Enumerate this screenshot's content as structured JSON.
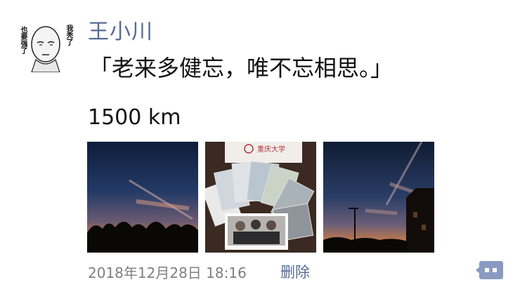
{
  "post": {
    "user_name": "王小川",
    "text": "「老来多健忘，唯不忘相思。」",
    "distance": "1500 km",
    "timestamp": "2018年12月28日 18:16",
    "delete_label": "删除",
    "photos": [
      {
        "subject": "dusk sky with contrail over tree silhouettes"
      },
      {
        "subject": "fanned instant photos on a university envelope"
      },
      {
        "subject": "dusk sky with contrail, street lamp and building"
      }
    ]
  },
  "avatar": {
    "left_text": "也要强了",
    "right_text": "我秃了"
  },
  "colors": {
    "link": "#576b95",
    "action_button": "#8a9ac2",
    "timestamp": "#7f7f7f"
  }
}
